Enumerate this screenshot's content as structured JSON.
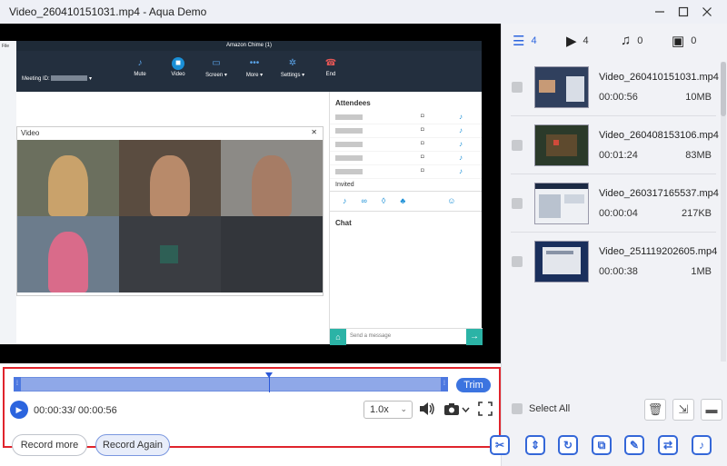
{
  "window": {
    "title": "Video_260410151031.mp4 - Aqua Demo",
    "minimize_icon": "minimize-icon",
    "maximize_icon": "maximize-icon",
    "close_icon": "close-icon"
  },
  "preview": {
    "app_title": "Amazon Chime (1)",
    "meeting_label": "Meeting ID:",
    "controls": [
      "Mute",
      "Video",
      "Screen ▾",
      "More ▾",
      "Settings ▾",
      "End"
    ],
    "video_panel_title": "Video",
    "attendees_title": "Attendees",
    "invited_label": "Invited",
    "chat_title": "Chat",
    "message_placeholder": "Send a message",
    "sidebar_labels": [
      "File"
    ]
  },
  "editor": {
    "trim_label": "Trim",
    "time_display": "00:00:33/ 00:00:56",
    "progress": 0.589,
    "speed": "1.0x",
    "volume_icon": "volume-icon",
    "screenshot_icon": "camera-icon",
    "fullscreen_icon": "fullscreen-icon"
  },
  "bottom": {
    "record_more": "Record more",
    "record_again": "Record Again"
  },
  "filters": [
    {
      "icon": "list-icon",
      "count": "4",
      "active": true
    },
    {
      "icon": "video-icon",
      "count": "4",
      "active": false
    },
    {
      "icon": "music-icon",
      "count": "0",
      "active": false
    },
    {
      "icon": "image-icon",
      "count": "0",
      "active": false
    }
  ],
  "files": [
    {
      "name": "Video_260410151031.mp4",
      "duration": "00:00:56",
      "size": "10MB"
    },
    {
      "name": "Video_260408153106.mp4",
      "duration": "00:01:24",
      "size": "83MB"
    },
    {
      "name": "Video_260317165537.mp4",
      "duration": "00:00:04",
      "size": "217KB"
    },
    {
      "name": "Video_251119202605.mp4",
      "duration": "00:00:38",
      "size": "1MB"
    }
  ],
  "select_all_label": "Select All",
  "actions": [
    "scissors-icon",
    "split-icon",
    "rotate-icon",
    "merge-icon",
    "edit-icon",
    "compress-icon",
    "audio-icon"
  ],
  "colors": {
    "accent": "#2b64de",
    "highlight_border": "#e0242c"
  }
}
